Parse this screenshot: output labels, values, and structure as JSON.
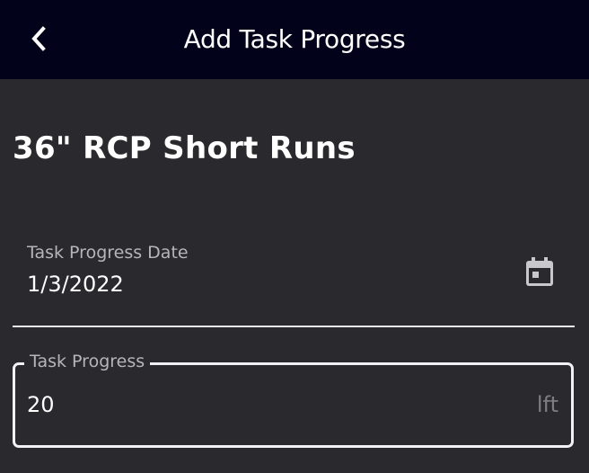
{
  "appbar": {
    "title": "Add Task Progress",
    "back_icon": "chevron-left-icon",
    "background": "#02031a"
  },
  "task": {
    "name": "36\" RCP Short Runs"
  },
  "date_field": {
    "label": "Task Progress Date",
    "value": "1/3/2022",
    "icon": "calendar-icon"
  },
  "progress_field": {
    "label": "Task Progress",
    "value": "20",
    "unit": "lft"
  },
  "colors": {
    "background": "#2a2a2e",
    "label": "#b5b5ba",
    "text": "#ffffff"
  }
}
